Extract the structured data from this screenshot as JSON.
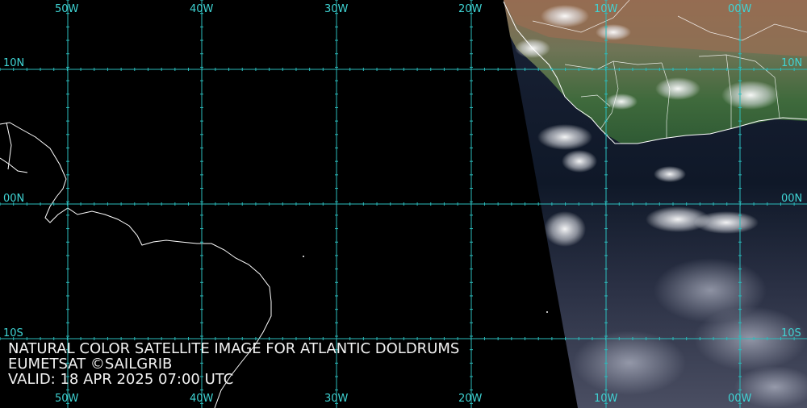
{
  "map": {
    "grid_color": "#2bbcbc",
    "ocean_color": "#000000",
    "coast_color": "#ffffff",
    "top_lon_labels": [
      "50W",
      "40W",
      "30W",
      "20W",
      "10W",
      "00W"
    ],
    "bottom_lon_labels": [
      "50W",
      "40W",
      "30W",
      "20W",
      "10W",
      "00W"
    ],
    "left_lat_labels": [
      "10N",
      "00N",
      "10S"
    ],
    "right_lat_labels": [
      "10N",
      "00N",
      "10S"
    ],
    "imagery": "natural color satellite swath over eastern Atlantic and West Africa"
  },
  "caption": {
    "line1": "NATURAL COLOR SATELLITE IMAGE FOR ATLANTIC DOLDRUMS",
    "line2": "EUMETSAT ©SAILGRIB",
    "line3": "VALID:  18 APR 2025 07:00 UTC"
  }
}
